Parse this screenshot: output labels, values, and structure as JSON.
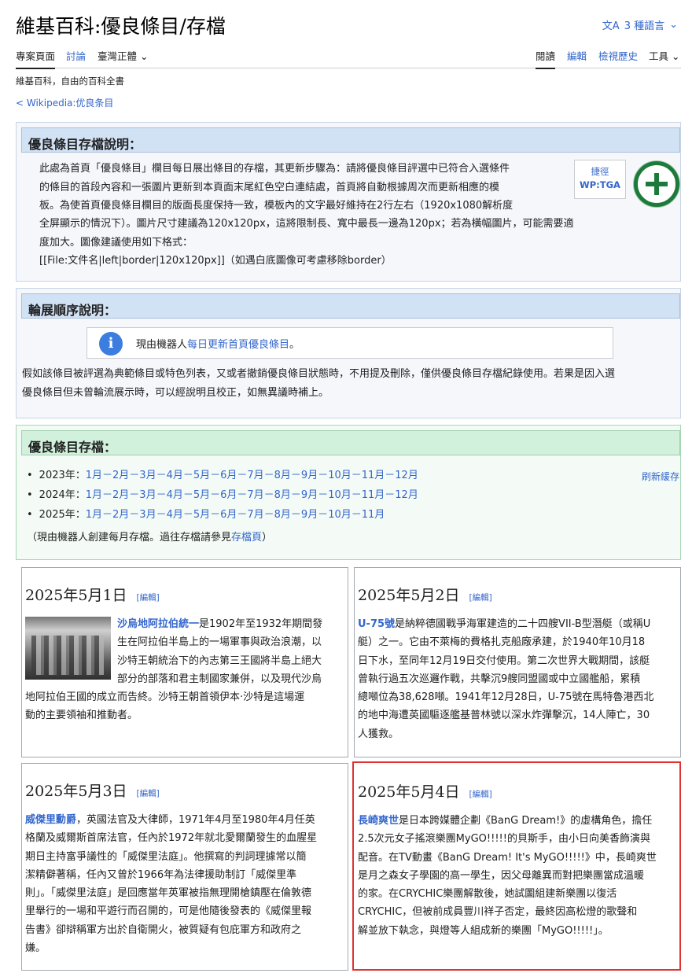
{
  "page": {
    "title": "維基百科:優良條目/存檔",
    "languages": "3 種語言",
    "tabs": {
      "project": "專案頁面",
      "talk": "討論",
      "variant": "臺灣正體",
      "read": "閱讀",
      "edit": "編輯",
      "history": "檢視歷史",
      "tools": "工具"
    },
    "tagline": "維基百科，自由的百科全書",
    "backlink": "< Wikipedia:优良条目"
  },
  "box1": {
    "heading": "優良條目存檔說明：",
    "lines": [
      "此處為首頁「優良條目」欄目每日展出條目的存檔，其更新步驟為：請將優良條目評選中已符合入選條件",
      "的條目的首段內容和一張圖片更新到本頁面末尾紅色空白連結處，首頁將自動根據周次而更新相應的模",
      "板。為使首頁優良條目欄目的版面長度保持一致，模板內的文字最好維持在2行左右（1920x1080解析度",
      "全屏顯示的情況下）。圖片尺寸建議為120x120px，這將限制長、寬中最長一邊為120px；若為橫幅圖片，可能需要適",
      "度加大。圖像建議使用如下格式：",
      "[[File:文件名|left|border|120x120px]]（如遇白底圖像可考慮移除border）"
    ],
    "shortcut_label": "捷徑",
    "shortcut": "WP:TGA"
  },
  "box2": {
    "heading": "輪展順序說明：",
    "notice_prefix": "現由機器人",
    "notice_link": "每日更新首頁優良條目",
    "notice_suffix": "。",
    "lines": [
      "假如該條目被評選為典範條目或特色列表，又或者撤銷優良條目狀態時，不用提及刪除，僅供優良條目存檔紀錄使用。若果是因入選",
      "優良條目但未曾輪流展示時，可以經說明且校正，如無異議時補上。"
    ]
  },
  "box3": {
    "heading": "優良條目存檔：",
    "rows": [
      {
        "label": "2023年：",
        "months": "1月－2月－3月－4月－5月－6月－7月－8月－9月－10月－11月－12月"
      },
      {
        "label": "2024年：",
        "months": "1月－2月－3月－4月－5月－6月－7月－8月－9月－10月－11月－12月"
      },
      {
        "label": "2025年：",
        "months": "1月－2月－3月－4月－5月－6月－7月－8月－9月－10月－11月"
      }
    ],
    "refresh": "刷新緩存",
    "footer_prefix": "（現由機器人創建每月存檔。過往存檔請參見",
    "footer_link": "存檔頁",
    "footer_suffix": "）"
  },
  "edit_label": "[編輯]",
  "cards": [
    {
      "date": "2025年5月1日",
      "lead": "沙烏地阿拉伯統一",
      "lines": [
        "是1902年至1932年期間發",
        "生在阿拉伯半島上的一場軍事與政治浪潮，以",
        "沙特王朝統治下的內志第三王國將半島上絕大",
        "部分的部落和君主制國家兼併，以及現代沙烏",
        "地阿拉伯王國的成立而告終。沙特王朝首領伊本·沙特是這場運",
        "動的主要領袖和推動者。"
      ]
    },
    {
      "date": "2025年5月2日",
      "lead": "U-75號",
      "lines": [
        "是納粹德國戰爭海軍建造的二十四艘VII-B型潛艇（或稱U",
        "艇）之一。它由不萊梅的費格扎克船廠承建，於1940年10月18",
        "日下水，至同年12月19日交付使用。第二次世界大戰期間，該艇",
        "曾執行過五次巡邏作戰，共擊沉9艘同盟國或中立國艦船，累積",
        "總噸位為38,628噸。1941年12月28日，U-75號在馬特魯港西北",
        "的地中海遭英國驅逐艦基普林號以深水炸彈擊沉，14人陣亡，30",
        "人獲救。"
      ]
    },
    {
      "date": "2025年5月3日",
      "lead": "威傑里勳爵",
      "lines": [
        "，英國法官及大律師，1971年4月至1980年4月任英",
        "格蘭及威爾斯首席法官，任內於1972年就北愛爾蘭發生的血腥星",
        "期日主持富爭議性的「威傑里法庭」。他撰寫的判詞理據常以簡",
        "潔精僻著稱，任內又曾於1966年為法律援助制訂「威傑里準",
        "則」。「威傑里法庭」是回應當年英軍被指無理開槍鎮壓在倫敦德",
        "里舉行的一場和平遊行而召開的，可是他隨後發表的《威傑里報",
        "告書》卻辯稱軍方出於自衛開火，被質疑有包庇軍方和政府之",
        "嫌。"
      ]
    },
    {
      "date": "2025年5月4日",
      "lead": "長崎爽世",
      "lines": [
        "是日本跨媒體企劃《BanG Dream!》的虛構角色，擔任",
        "2.5次元女子搖滾樂團MyGO!!!!!的貝斯手，由小日向美香飾演與",
        "配音。在TV動畫《BanG Dream! It's MyGO!!!!!》中，長崎爽世",
        "是月之森女子學園的高一學生，因父母離異而對把樂團當成溫暖",
        "的家。在CRYCHIC樂團解散後，她試圖組建新樂團以復活",
        "CRYCHIC，但被前成員豐川祥子否定，最終因高松燈的歌聲和",
        "解並放下執念，與燈等人組成新的樂團「MyGO!!!!!」。"
      ]
    }
  ]
}
